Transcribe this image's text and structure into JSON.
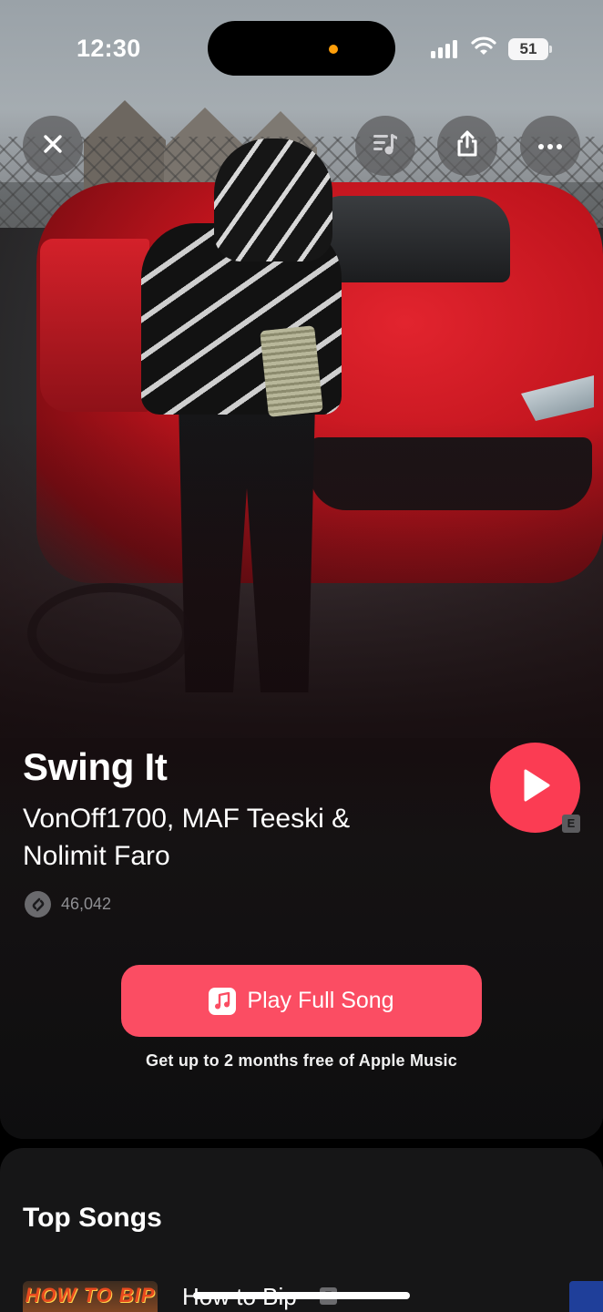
{
  "status_bar": {
    "time": "12:30",
    "battery": "51",
    "icons": [
      "signal-icon",
      "wifi-icon",
      "battery-icon"
    ]
  },
  "top_buttons": {
    "close": "close-icon",
    "queue": "queue-music-icon",
    "share": "share-icon",
    "more": "more-icon"
  },
  "song": {
    "title": "Swing It",
    "artists": "VonOff1700, MAF Teeski & Nolimit Faro",
    "explicit_badge": "E",
    "shazam_count": "46,042"
  },
  "cta": {
    "label": "Play Full Song",
    "promo": "Get up to 2 months free of Apple Music",
    "icon": "music-note-icon"
  },
  "top_songs": {
    "title": "Top Songs",
    "items": [
      {
        "title": "How to Bip",
        "explicit": "E",
        "thumb_text": "HOW TO BIP"
      }
    ]
  },
  "colors": {
    "accent": "#fb4d63",
    "play_circle": "#fb3c53",
    "background": "#0e0e0f"
  }
}
